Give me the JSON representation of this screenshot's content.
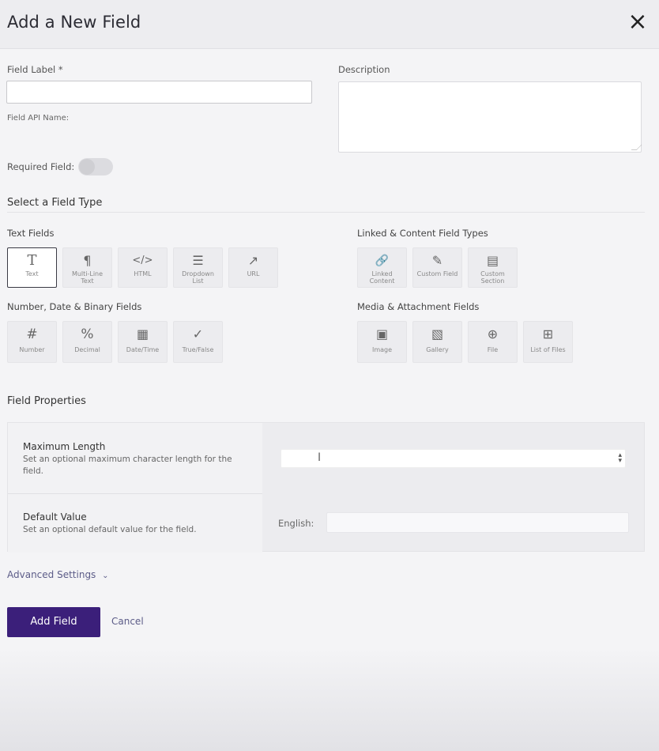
{
  "header": {
    "title": "Add a New Field",
    "close_icon": "×"
  },
  "form": {
    "field_label": "Field Label *",
    "field_label_value": "",
    "api_name_label": "Field API Name:",
    "description_label": "Description",
    "description_value": "",
    "required_label": "Required Field:",
    "required_on": false
  },
  "field_type": {
    "section_title": "Select a Field Type",
    "groups": {
      "text": {
        "title": "Text Fields",
        "tiles": [
          {
            "label": "Text",
            "icon": "T",
            "selected": true
          },
          {
            "label": "Multi-Line Text",
            "icon": "¶"
          },
          {
            "label": "HTML",
            "icon": "</>"
          },
          {
            "label": "Dropdown List",
            "icon": "☰"
          },
          {
            "label": "URL",
            "icon": "↗"
          }
        ]
      },
      "linked": {
        "title": "Linked & Content Field Types",
        "tiles": [
          {
            "label": "Linked Content",
            "icon": "🔗"
          },
          {
            "label": "Custom Field",
            "icon": "✎"
          },
          {
            "label": "Custom Section",
            "icon": "▤"
          }
        ]
      },
      "number": {
        "title": "Number, Date & Binary Fields",
        "tiles": [
          {
            "label": "Number",
            "icon": "#"
          },
          {
            "label": "Decimal",
            "icon": "%"
          },
          {
            "label": "Date/Time",
            "icon": "▦"
          },
          {
            "label": "True/False",
            "icon": "✓"
          }
        ]
      },
      "media": {
        "title": "Media & Attachment Fields",
        "tiles": [
          {
            "label": "Image",
            "icon": "▣"
          },
          {
            "label": "Gallery",
            "icon": "▧"
          },
          {
            "label": "File",
            "icon": "⊕"
          },
          {
            "label": "List of Files",
            "icon": "⊞"
          }
        ]
      }
    }
  },
  "properties": {
    "section_title": "Field Properties",
    "max_length": {
      "name": "Maximum Length",
      "desc": "Set an optional maximum character length for the field.",
      "value": ""
    },
    "default_value": {
      "name": "Default Value",
      "desc": "Set an optional default value for the field.",
      "lang_label": "English:",
      "value": ""
    }
  },
  "advanced": {
    "label": "Advanced Settings",
    "chevron": "⌄"
  },
  "actions": {
    "add_label": "Add Field",
    "cancel_label": "Cancel"
  },
  "colors": {
    "primary": "#3b1f7a",
    "link": "#5c5c88"
  }
}
